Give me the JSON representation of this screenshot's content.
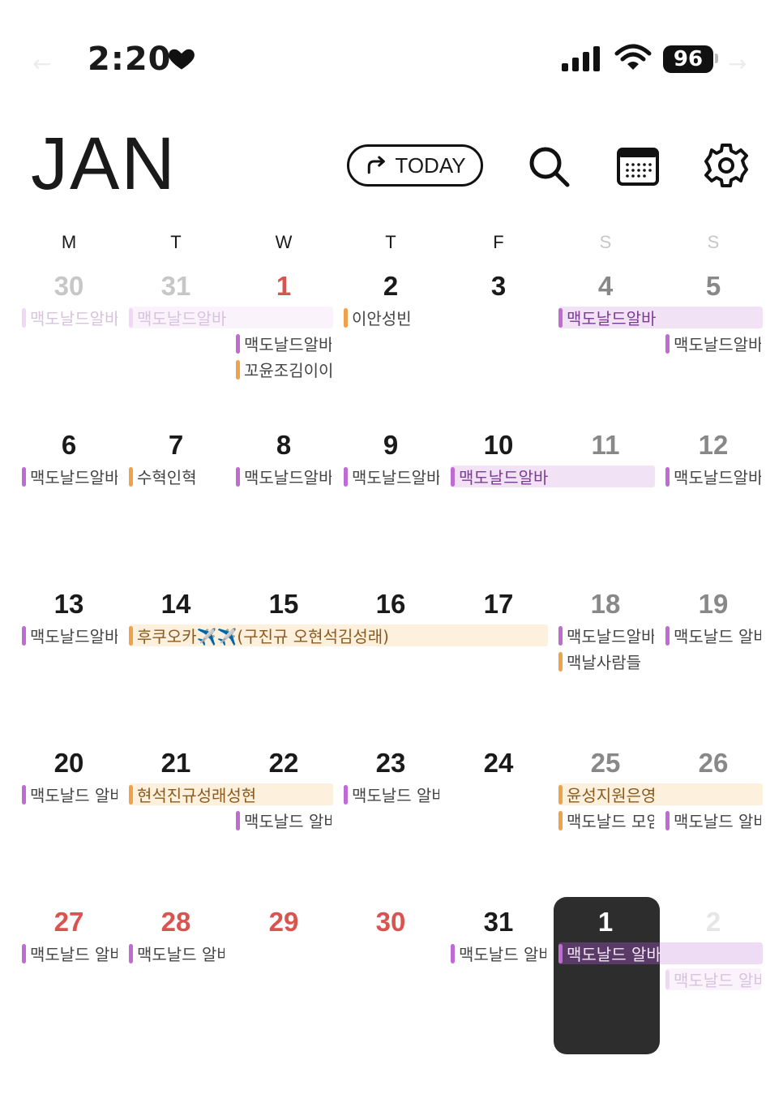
{
  "status_bar": {
    "time": "2:20",
    "battery": "96"
  },
  "header": {
    "month": "JAN",
    "today_label": "TODAY"
  },
  "weekdays": [
    "M",
    "T",
    "W",
    "T",
    "F",
    "S",
    "S"
  ],
  "weeks": [
    {
      "days": [
        "30",
        "31",
        "1",
        "2",
        "3",
        "4",
        "5"
      ]
    },
    {
      "days": [
        "6",
        "7",
        "8",
        "9",
        "10",
        "11",
        "12"
      ]
    },
    {
      "days": [
        "13",
        "14",
        "15",
        "16",
        "17",
        "18",
        "19"
      ]
    },
    {
      "days": [
        "20",
        "21",
        "22",
        "23",
        "24",
        "25",
        "26"
      ]
    },
    {
      "days": [
        "27",
        "28",
        "29",
        "30",
        "31",
        "1",
        "2"
      ]
    }
  ],
  "events": {
    "w0": [
      "맥도날드알바",
      "맥도날드알바",
      "이안성빈",
      "맥도날드알바",
      "맥도날드알바",
      "꼬윤조김이이",
      "맥도날드알바"
    ],
    "w1": [
      "맥도날드알바",
      "수혁인혁",
      "맥도날드알바",
      "맥도날드알바",
      "맥도날드알바",
      "맥도날드알바"
    ],
    "w2": [
      "맥도날드알바",
      "후쿠오카✈️✈️(구진규 오현석김성래)",
      "맥도날드알바",
      "맥도날드 알바",
      "맥날사람들"
    ],
    "w3": [
      "맥도날드 알바",
      "현석진규성래성현",
      "맥도날드 알바",
      "맥도날드 알바",
      "윤성지원은영",
      "맥도날드 모임",
      "맥도날드 알바"
    ],
    "w4": [
      "맥도날드 알바",
      "맥도날드 알바",
      "맥도날드 알바",
      "맥도날드 알바",
      "맥도날드 알바"
    ]
  },
  "colors": {
    "accent_purple": "#c06ad3",
    "accent_orange": "#f0a24a",
    "holiday_red": "#d9534f",
    "selected_bg": "#2d2d2d"
  },
  "icons": [
    "heart-icon",
    "signal-icon",
    "wifi-icon",
    "share-arrow-icon",
    "search-icon",
    "calendar-icon",
    "gear-icon"
  ]
}
